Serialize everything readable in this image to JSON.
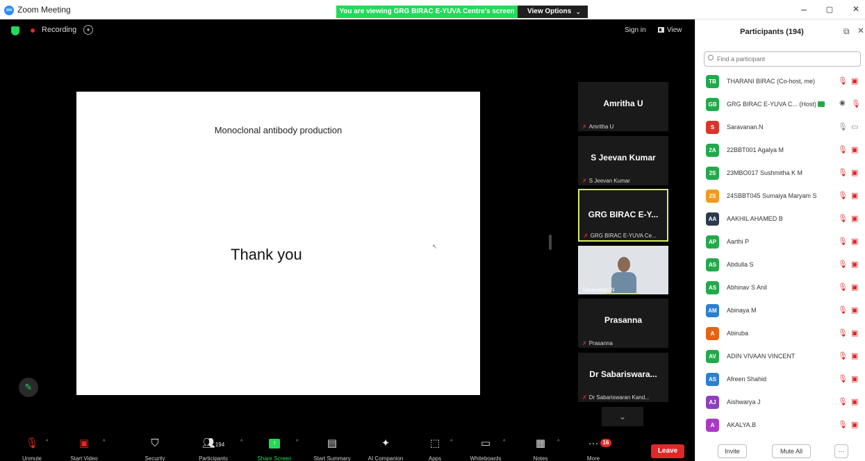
{
  "window": {
    "title": "Zoom Meeting",
    "minimize": "–",
    "restore": "▢",
    "close": "✕"
  },
  "banner": {
    "viewing": "You are viewing GRG BIRAC E-YUVA Centre's screen",
    "view_options": "View Options",
    "caret": "⌄"
  },
  "topbar": {
    "recording": "Recording",
    "sign_in": "Sign in",
    "view": "View"
  },
  "slide": {
    "title": "Monoclonal antibody production",
    "body": "Thank you"
  },
  "gallery": [
    {
      "name": "Amritha U",
      "label": "Amritha U"
    },
    {
      "name": "S Jeevan Kumar",
      "label": "S Jeevan Kumar"
    },
    {
      "name": "GRG BIRAC E-Y...",
      "label": "GRG BIRAC E-YUVA Ce..."
    },
    {
      "name": "",
      "label": "Saravanan.N"
    },
    {
      "name": "Prasanna",
      "label": "Prasanna"
    },
    {
      "name": "Dr Sabariswara...",
      "label": "Dr Sabariswaran Kand..."
    }
  ],
  "toolbar": {
    "unmute": "Unmute",
    "start_video": "Start Video",
    "security": "Security",
    "participants": "Participants",
    "participants_count": "194",
    "share_screen": "Share Screen",
    "start_summary": "Start Summary",
    "ai_companion": "AI Companion",
    "apps": "Apps",
    "whiteboards": "Whiteboards",
    "notes": "Notes",
    "more": "More",
    "more_badge": "16",
    "leave": "Leave"
  },
  "panel": {
    "title": "Participants (194)",
    "search_placeholder": "Find a participant",
    "invite": "Invite",
    "mute_all": "Mute All",
    "more": "···",
    "participants": [
      {
        "initials": "TB",
        "name": "THARANI BIRAC (Co-host, me)",
        "color": "#23a94b"
      },
      {
        "initials": "GB",
        "name": "GRG BIRAC E-YUVA C... (Host)",
        "color": "#23a94b"
      },
      {
        "initials": "S",
        "name": "Saravanan.N",
        "color": "#d9362b"
      },
      {
        "initials": "2A",
        "name": "22BBT001 Agalya M",
        "color": "#23a94b"
      },
      {
        "initials": "2S",
        "name": "23MBO017 Sushmitha K M",
        "color": "#23a94b"
      },
      {
        "initials": "2S",
        "name": "24SBBT045 Sumaiya Maryam S",
        "color": "#f39a1e"
      },
      {
        "initials": "AA",
        "name": "AAKHIL AHAMED B",
        "color": "#2d3a4f"
      },
      {
        "initials": "AP",
        "name": "Aarthi P",
        "color": "#23a94b"
      },
      {
        "initials": "AS",
        "name": "Abdulla S",
        "color": "#23a94b"
      },
      {
        "initials": "AS",
        "name": "Abhinav S Anil",
        "color": "#23a94b"
      },
      {
        "initials": "AM",
        "name": "Abinaya M",
        "color": "#2c7fd1"
      },
      {
        "initials": "A",
        "name": "Abiruba",
        "color": "#e36414"
      },
      {
        "initials": "AV",
        "name": "ADIN VIVAAN VINCENT",
        "color": "#23a94b"
      },
      {
        "initials": "AS",
        "name": "Afreen Shahid",
        "color": "#2c7fd1"
      },
      {
        "initials": "AJ",
        "name": "Aishwarya J",
        "color": "#8e3fbf"
      },
      {
        "initials": "A",
        "name": "AKALYA.B",
        "color": "#a93ac2"
      }
    ]
  },
  "icons": {
    "shield": "shield-icon",
    "pencil": "✎",
    "chevron_down": "⌄"
  }
}
